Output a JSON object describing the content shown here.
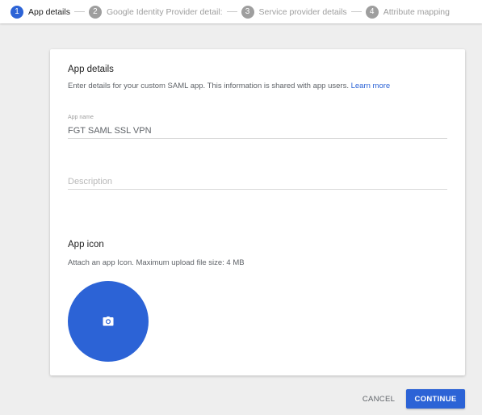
{
  "stepper": {
    "steps": [
      {
        "number": "1",
        "label": "App details",
        "active": true
      },
      {
        "number": "2",
        "label": "Google Identity Provider detail:",
        "active": false
      },
      {
        "number": "3",
        "label": "Service provider details",
        "active": false
      },
      {
        "number": "4",
        "label": "Attribute mapping",
        "active": false
      }
    ]
  },
  "card": {
    "title": "App details",
    "description": "Enter details for your custom SAML app. This information is shared with app users.",
    "learn_more": "Learn more",
    "app_name": {
      "label": "App name",
      "value": "FGT SAML SSL VPN"
    },
    "description_field": {
      "placeholder": "Description",
      "value": ""
    },
    "app_icon": {
      "title": "App icon",
      "description": "Attach an app Icon. Maximum upload file size: 4 MB",
      "icon": "camera-icon"
    }
  },
  "actions": {
    "cancel": "CANCEL",
    "continue": "CONTINUE"
  },
  "colors": {
    "accent": "#2c63d6",
    "inactive_step": "#9e9e9e",
    "background": "#eeeeee"
  }
}
